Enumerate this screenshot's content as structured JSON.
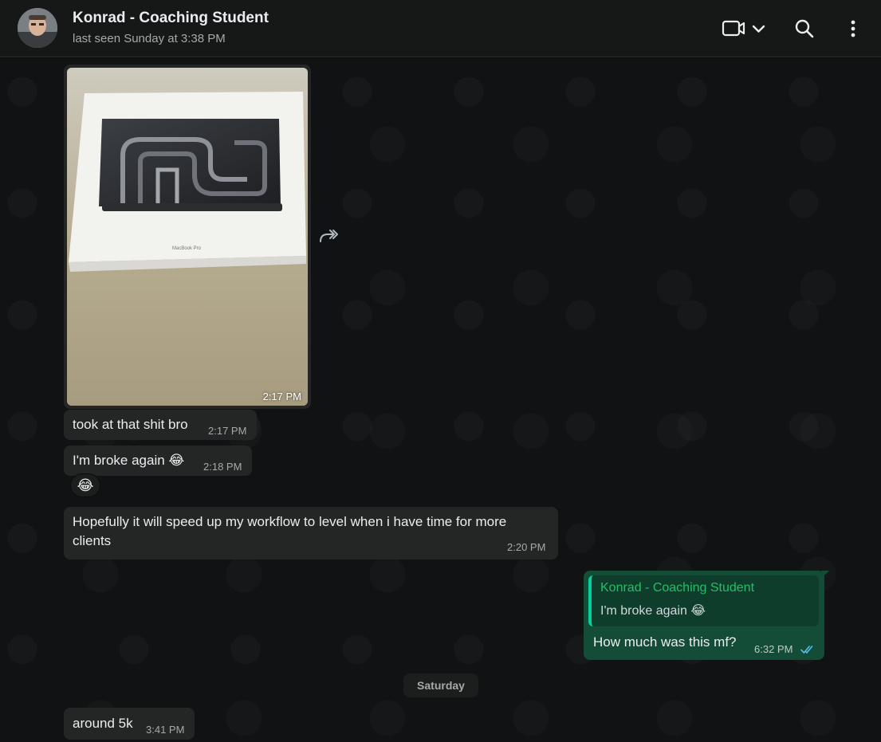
{
  "header": {
    "contact_name": "Konrad - Coaching Student",
    "status": "last seen Sunday at 3:38 PM"
  },
  "icons": [
    "video-call-icon",
    "chevron-down-icon",
    "search-icon",
    "kebab-menu-icon",
    "forward-icon",
    "double-check-icon"
  ],
  "colors": {
    "incoming_bubble": "#242626",
    "outgoing_bubble": "#144d37",
    "quote_accent": "#06cf9c",
    "read_ticks": "#53bdeb"
  },
  "messages": [
    {
      "type": "image",
      "direction": "in",
      "caption": "MacBook Pro",
      "time": "2:17 PM"
    },
    {
      "type": "text",
      "direction": "in",
      "text": "took at that shit bro",
      "time": "2:17 PM"
    },
    {
      "type": "text",
      "direction": "in",
      "text": "I'm broke again 😂",
      "time": "2:18 PM",
      "reaction": "😂"
    },
    {
      "type": "text",
      "direction": "in",
      "line1": "Hopefully it will speed up my workflow to level when i have time for more",
      "line2": "clients",
      "time": "2:20 PM"
    },
    {
      "type": "reply",
      "direction": "out",
      "quoted_name": "Konrad - Coaching Student",
      "quoted_text": "I'm broke again 😂",
      "text": "How much was this mf?",
      "time": "6:32 PM",
      "status": "read"
    },
    {
      "type": "date_divider",
      "label": "Saturday"
    },
    {
      "type": "text",
      "direction": "in",
      "text": "around 5k",
      "time": "3:41 PM"
    }
  ]
}
